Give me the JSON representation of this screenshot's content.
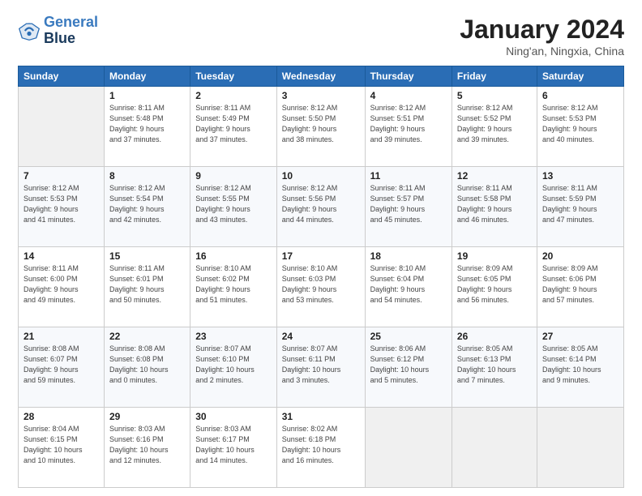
{
  "header": {
    "logo_line1": "General",
    "logo_line2": "Blue",
    "title": "January 2024",
    "subtitle": "Ning'an, Ningxia, China"
  },
  "weekdays": [
    "Sunday",
    "Monday",
    "Tuesday",
    "Wednesday",
    "Thursday",
    "Friday",
    "Saturday"
  ],
  "weeks": [
    [
      {
        "day": "",
        "info": ""
      },
      {
        "day": "1",
        "info": "Sunrise: 8:11 AM\nSunset: 5:48 PM\nDaylight: 9 hours\nand 37 minutes."
      },
      {
        "day": "2",
        "info": "Sunrise: 8:11 AM\nSunset: 5:49 PM\nDaylight: 9 hours\nand 37 minutes."
      },
      {
        "day": "3",
        "info": "Sunrise: 8:12 AM\nSunset: 5:50 PM\nDaylight: 9 hours\nand 38 minutes."
      },
      {
        "day": "4",
        "info": "Sunrise: 8:12 AM\nSunset: 5:51 PM\nDaylight: 9 hours\nand 39 minutes."
      },
      {
        "day": "5",
        "info": "Sunrise: 8:12 AM\nSunset: 5:52 PM\nDaylight: 9 hours\nand 39 minutes."
      },
      {
        "day": "6",
        "info": "Sunrise: 8:12 AM\nSunset: 5:53 PM\nDaylight: 9 hours\nand 40 minutes."
      }
    ],
    [
      {
        "day": "7",
        "info": "Sunrise: 8:12 AM\nSunset: 5:53 PM\nDaylight: 9 hours\nand 41 minutes."
      },
      {
        "day": "8",
        "info": "Sunrise: 8:12 AM\nSunset: 5:54 PM\nDaylight: 9 hours\nand 42 minutes."
      },
      {
        "day": "9",
        "info": "Sunrise: 8:12 AM\nSunset: 5:55 PM\nDaylight: 9 hours\nand 43 minutes."
      },
      {
        "day": "10",
        "info": "Sunrise: 8:12 AM\nSunset: 5:56 PM\nDaylight: 9 hours\nand 44 minutes."
      },
      {
        "day": "11",
        "info": "Sunrise: 8:11 AM\nSunset: 5:57 PM\nDaylight: 9 hours\nand 45 minutes."
      },
      {
        "day": "12",
        "info": "Sunrise: 8:11 AM\nSunset: 5:58 PM\nDaylight: 9 hours\nand 46 minutes."
      },
      {
        "day": "13",
        "info": "Sunrise: 8:11 AM\nSunset: 5:59 PM\nDaylight: 9 hours\nand 47 minutes."
      }
    ],
    [
      {
        "day": "14",
        "info": "Sunrise: 8:11 AM\nSunset: 6:00 PM\nDaylight: 9 hours\nand 49 minutes."
      },
      {
        "day": "15",
        "info": "Sunrise: 8:11 AM\nSunset: 6:01 PM\nDaylight: 9 hours\nand 50 minutes."
      },
      {
        "day": "16",
        "info": "Sunrise: 8:10 AM\nSunset: 6:02 PM\nDaylight: 9 hours\nand 51 minutes."
      },
      {
        "day": "17",
        "info": "Sunrise: 8:10 AM\nSunset: 6:03 PM\nDaylight: 9 hours\nand 53 minutes."
      },
      {
        "day": "18",
        "info": "Sunrise: 8:10 AM\nSunset: 6:04 PM\nDaylight: 9 hours\nand 54 minutes."
      },
      {
        "day": "19",
        "info": "Sunrise: 8:09 AM\nSunset: 6:05 PM\nDaylight: 9 hours\nand 56 minutes."
      },
      {
        "day": "20",
        "info": "Sunrise: 8:09 AM\nSunset: 6:06 PM\nDaylight: 9 hours\nand 57 minutes."
      }
    ],
    [
      {
        "day": "21",
        "info": "Sunrise: 8:08 AM\nSunset: 6:07 PM\nDaylight: 9 hours\nand 59 minutes."
      },
      {
        "day": "22",
        "info": "Sunrise: 8:08 AM\nSunset: 6:08 PM\nDaylight: 10 hours\nand 0 minutes."
      },
      {
        "day": "23",
        "info": "Sunrise: 8:07 AM\nSunset: 6:10 PM\nDaylight: 10 hours\nand 2 minutes."
      },
      {
        "day": "24",
        "info": "Sunrise: 8:07 AM\nSunset: 6:11 PM\nDaylight: 10 hours\nand 3 minutes."
      },
      {
        "day": "25",
        "info": "Sunrise: 8:06 AM\nSunset: 6:12 PM\nDaylight: 10 hours\nand 5 minutes."
      },
      {
        "day": "26",
        "info": "Sunrise: 8:05 AM\nSunset: 6:13 PM\nDaylight: 10 hours\nand 7 minutes."
      },
      {
        "day": "27",
        "info": "Sunrise: 8:05 AM\nSunset: 6:14 PM\nDaylight: 10 hours\nand 9 minutes."
      }
    ],
    [
      {
        "day": "28",
        "info": "Sunrise: 8:04 AM\nSunset: 6:15 PM\nDaylight: 10 hours\nand 10 minutes."
      },
      {
        "day": "29",
        "info": "Sunrise: 8:03 AM\nSunset: 6:16 PM\nDaylight: 10 hours\nand 12 minutes."
      },
      {
        "day": "30",
        "info": "Sunrise: 8:03 AM\nSunset: 6:17 PM\nDaylight: 10 hours\nand 14 minutes."
      },
      {
        "day": "31",
        "info": "Sunrise: 8:02 AM\nSunset: 6:18 PM\nDaylight: 10 hours\nand 16 minutes."
      },
      {
        "day": "",
        "info": ""
      },
      {
        "day": "",
        "info": ""
      },
      {
        "day": "",
        "info": ""
      }
    ]
  ]
}
